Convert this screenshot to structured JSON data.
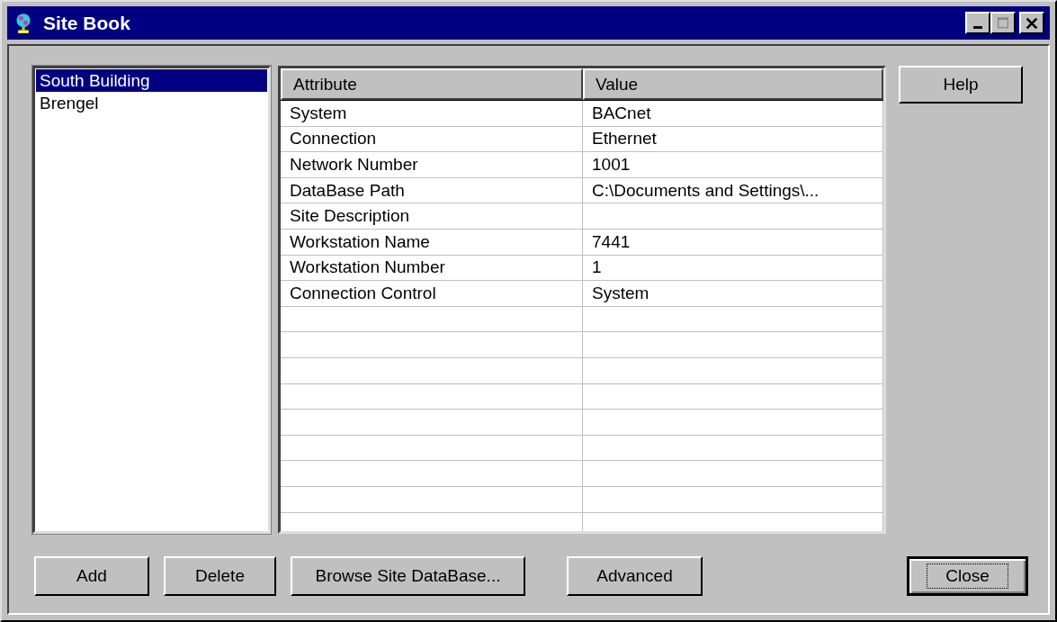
{
  "window": {
    "title": "Site Book"
  },
  "sites": [
    {
      "label": "South Building",
      "selected": true
    },
    {
      "label": "Brengel",
      "selected": false
    }
  ],
  "table": {
    "columns": [
      "Attribute",
      "Value"
    ],
    "rows": [
      [
        "System",
        "BACnet"
      ],
      [
        "Connection",
        "Ethernet"
      ],
      [
        "Network Number",
        "1001"
      ],
      [
        "DataBase Path",
        "C:\\Documents and Settings\\..."
      ],
      [
        "Site Description",
        ""
      ],
      [
        "Workstation Name",
        "7441"
      ],
      [
        "Workstation Number",
        "1"
      ],
      [
        "Connection Control",
        "System"
      ]
    ]
  },
  "side_buttons": [
    {
      "label": "Help",
      "focused": false
    }
  ],
  "buttons": [
    {
      "label": "Add",
      "focused": false
    },
    {
      "label": "Delete",
      "focused": false
    },
    {
      "label": "Browse Site DataBase...",
      "focused": false
    },
    {
      "label": "Advanced",
      "focused": false
    },
    {
      "label": "Close",
      "focused": true
    }
  ]
}
